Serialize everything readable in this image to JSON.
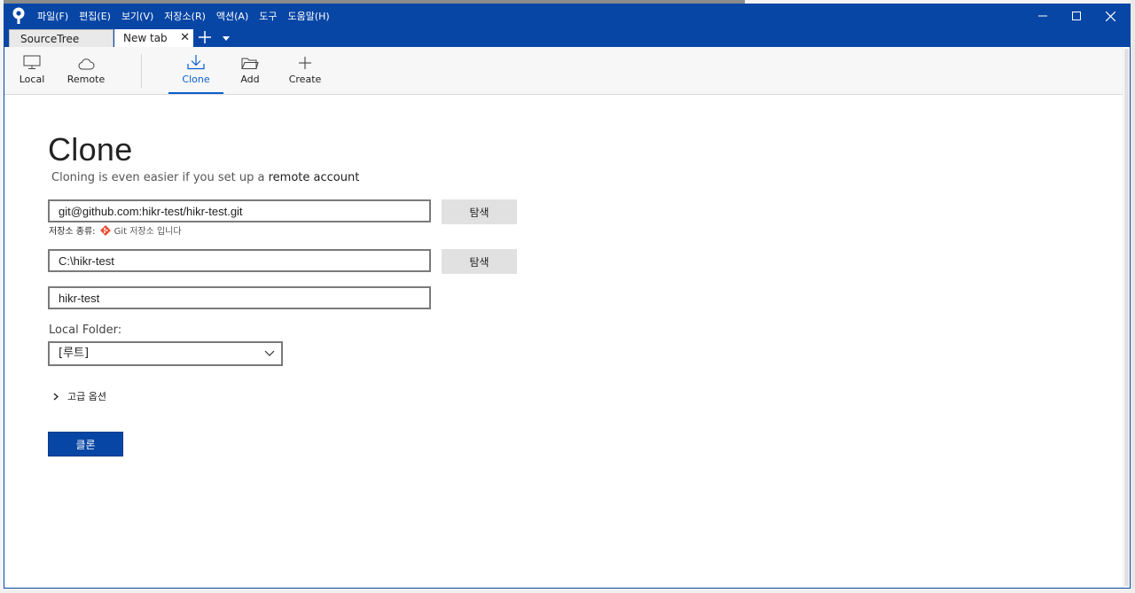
{
  "window": {
    "menu": [
      "파일(F)",
      "편집(E)",
      "보기(V)",
      "저장소(R)",
      "액션(A)",
      "도구",
      "도움말(H)"
    ]
  },
  "tabs": [
    {
      "label": "SourceTree"
    },
    {
      "label": "New tab"
    }
  ],
  "toolbar": {
    "local": "Local",
    "remote": "Remote",
    "clone": "Clone",
    "add": "Add",
    "create": "Create"
  },
  "clone": {
    "title": "Clone",
    "subtitle_prefix": "Cloning is even easier if you set up a",
    "subtitle_link": "remote account",
    "source_url": "git@github.com:hikr-test/hikr-test.git",
    "browse_label": "탐색",
    "repo_type_label": "저장소 종류:",
    "repo_type_value": "Git 저장소 입니다",
    "dest_path": "C:\\hikr-test",
    "name": "hikr-test",
    "local_folder_label": "Local Folder:",
    "local_folder_value": "[루트]",
    "advanced_label": "고급 옵션",
    "clone_button": "클론"
  },
  "colors": {
    "accent": "#0846a5",
    "active_tab": "#0a5fcf",
    "git_icon": "#e84e31"
  }
}
